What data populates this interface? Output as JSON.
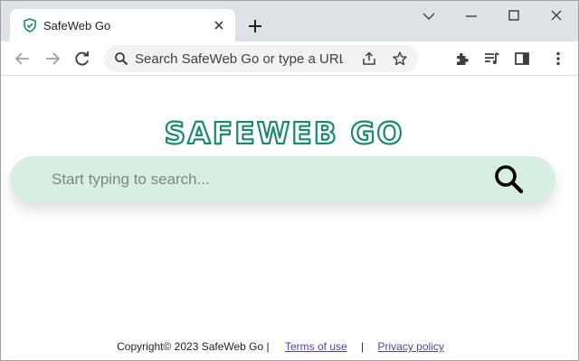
{
  "browser": {
    "tab": {
      "title": "SafeWeb Go"
    },
    "omnibox": {
      "placeholder": "Search SafeWeb Go or type a URL"
    },
    "icons": [
      "shield-favicon",
      "close-icon",
      "plus-icon",
      "chevron-down-icon",
      "minimize-icon",
      "maximize-icon",
      "close-window-icon",
      "back-arrow-icon",
      "forward-arrow-icon",
      "reload-icon",
      "search-icon",
      "share-icon",
      "star-icon",
      "puzzle-extensions-icon",
      "media-queue-icon",
      "side-panel-icon",
      "kebab-menu-icon"
    ]
  },
  "page": {
    "logo_text": "SAFEWEB GO",
    "search": {
      "placeholder": "Start typing to search..."
    },
    "footer": {
      "copyright": "Copyright© 2023 SafeWeb Go |",
      "terms": "Terms of use",
      "separator": "|",
      "privacy": "Privacy policy"
    }
  },
  "colors": {
    "accent": "#1a8a6a",
    "search_bg": "#d7efe1",
    "tabstrip_bg": "#dee1e6",
    "link": "#5b3fa0"
  }
}
